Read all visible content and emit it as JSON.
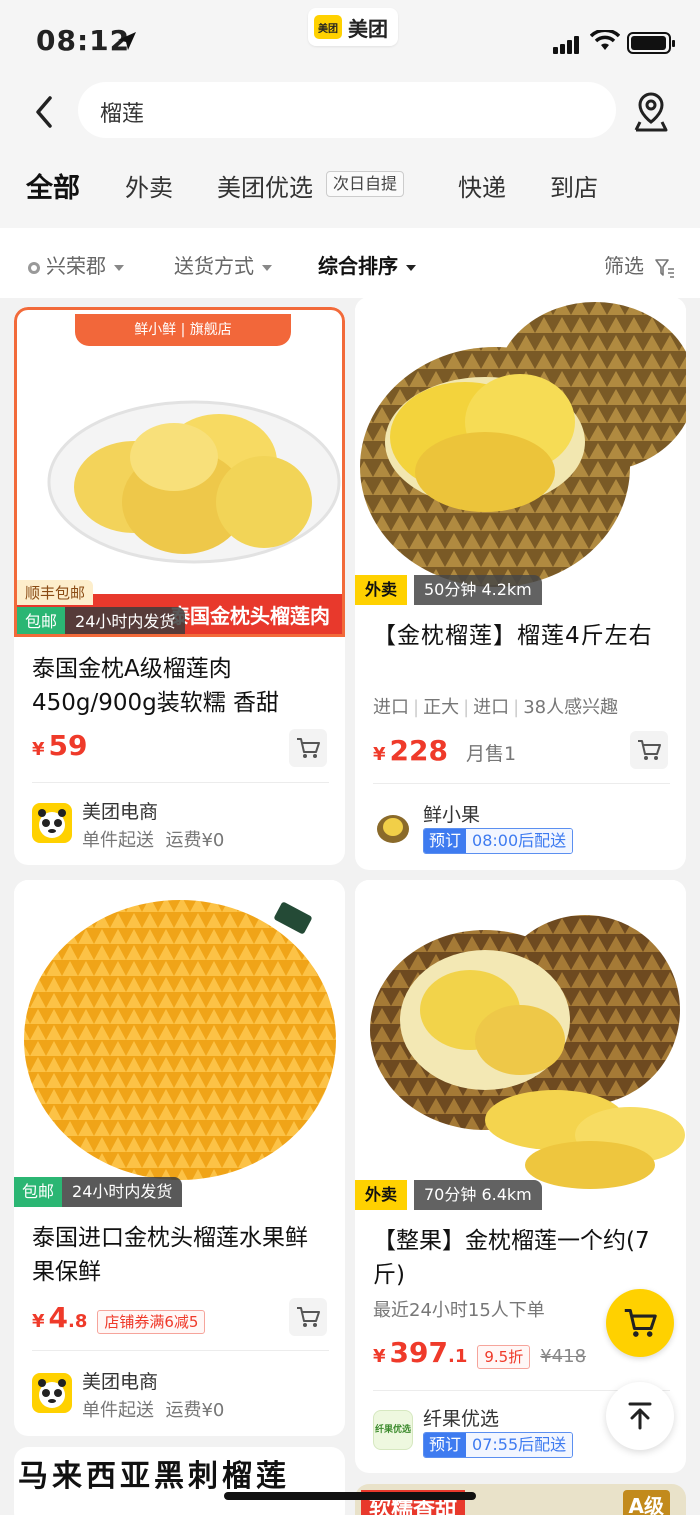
{
  "status_bar": {
    "time": "08:12",
    "app_name": "美团",
    "app_logo_text": "美团"
  },
  "search": {
    "query": "榴莲"
  },
  "tabs": [
    {
      "label": "全部",
      "active": true
    },
    {
      "label": "外卖"
    },
    {
      "label": "美团优选",
      "tag": "次日自提"
    },
    {
      "label": "快递"
    },
    {
      "label": "到店"
    }
  ],
  "filters": {
    "location": "兴荣郡",
    "delivery": "送货方式",
    "sort": "综合排序",
    "filter": "筛选"
  },
  "products": [
    {
      "banner": "旗舰店",
      "banner_brand": "鲜小鲜",
      "overlay_text": "泰国金枕头榴莲肉",
      "badge_top": "顺丰包邮",
      "badge_free": "包邮",
      "badge_ship": "24小时内发货",
      "title": "泰国金枕A级榴莲肉450g/900g装软糯 香甜",
      "price_yen": "¥",
      "price_int": "59",
      "shop_name": "美团电商",
      "shop_sub_1": "单件起送",
      "shop_sub_2": "运费¥0"
    },
    {
      "tag_type": "外卖",
      "tag_info": "50分钟  4.2km",
      "title": "【金枕榴莲】榴莲4斤左右",
      "attrs": [
        "进口",
        "正大",
        "进口",
        "38人感兴趣"
      ],
      "price_yen": "¥",
      "price_int": "228",
      "sales": "月售1",
      "shop_name": "鲜小果",
      "pre_label": "预订",
      "pre_time": "08:00后配送"
    },
    {
      "badge_free": "包邮",
      "badge_ship": "24小时内发货",
      "title": "泰国进口金枕头榴莲水果鲜果保鲜",
      "price_yen": "¥",
      "price_int": "4",
      "price_dec": ".8",
      "coupon": "店铺券满6减5",
      "shop_name": "美团电商",
      "shop_sub_1": "单件起送",
      "shop_sub_2": "运费¥0"
    },
    {
      "tag_type": "外卖",
      "tag_info": "70分钟  6.4km",
      "title": "【整果】金枕榴莲一个约(7斤)",
      "recent": "最近24小时15人下单",
      "price_yen": "¥",
      "price_int": "397",
      "price_dec": ".1",
      "discount": "9.5折",
      "orig_price": "¥418",
      "shop_name": "纤果优选",
      "shop_logo_text": "纤果优选",
      "pre_label": "预订",
      "pre_time": "07:55后配送"
    }
  ],
  "bottom_peek": {
    "left_title": "马来西亚黑刺榴莲",
    "right_banner": "软糯香甜",
    "right_badge": "A级"
  },
  "colors": {
    "brand": "#ffd100",
    "price": "#ef3a2a",
    "green": "#2bb673",
    "blue": "#3e7bf0"
  },
  "icons": [
    "location-arrow-icon",
    "back-icon",
    "map-pin-icon",
    "cart-icon",
    "back-to-top-icon",
    "filter-icon"
  ]
}
